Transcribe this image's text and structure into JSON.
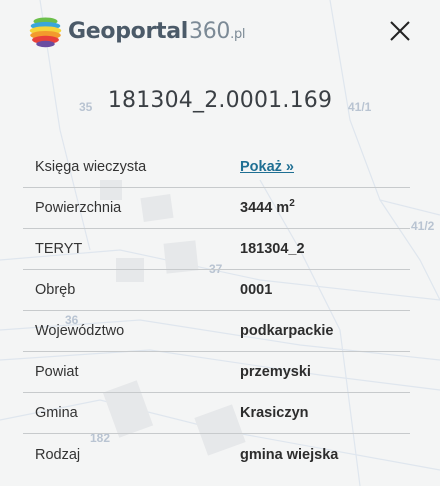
{
  "header": {
    "logo": {
      "brand": "Geoportal",
      "number": "360",
      "tld": ".pl",
      "colors": [
        "#e8403a",
        "#f39a2d",
        "#f5d43a",
        "#6bbf4a",
        "#3aa6d9",
        "#6a4ca0"
      ]
    },
    "close_icon": "close-icon"
  },
  "title": "181304_2.0001.169",
  "rows": [
    {
      "label": "Księga wieczysta",
      "value": "Pokaż »",
      "is_link": true
    },
    {
      "label": "Powierzchnia",
      "value": "3444 m",
      "sup": "2"
    },
    {
      "label": "TERYT",
      "value": "181304_2"
    },
    {
      "label": "Obręb",
      "value": "0001"
    },
    {
      "label": "Województwo",
      "value": "podkarpackie"
    },
    {
      "label": "Powiat",
      "value": "przemyski"
    },
    {
      "label": "Gmina",
      "value": "Krasiczyn"
    },
    {
      "label": "Rodzaj",
      "value": "gmina wiejska"
    }
  ],
  "map_labels": [
    "35",
    "41/1",
    "41/2",
    "37",
    "36",
    "182"
  ],
  "colors": {
    "link": "#1f6f93",
    "background": "#f4f5f5",
    "divider": "#c7cacc"
  }
}
